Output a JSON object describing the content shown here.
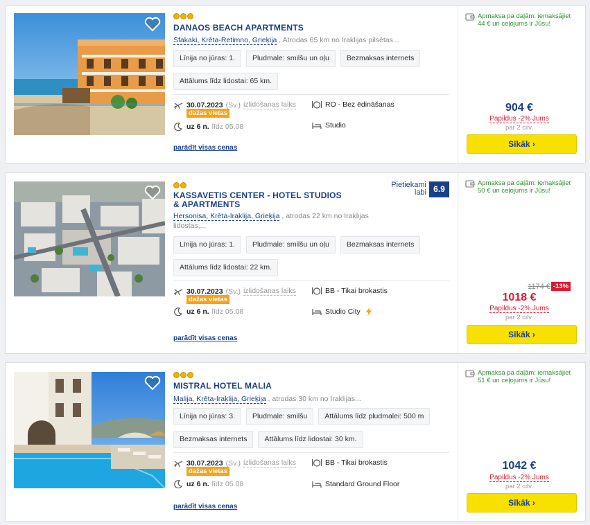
{
  "listings": [
    {
      "name": "DANAOS BEACH APARTMENTS",
      "stars": 3,
      "location_link": "Sfakaki, Krēta-Retimno, Grieķija",
      "location_rest": " , Atrodas 65 km no Iraklijas pilsētas...",
      "tags": [
        "Līnija no jūras: 1.",
        "Pludmale: smilšu un oļu",
        "Bezmaksas internets",
        "Attālums līdz lidostai: 65 km."
      ],
      "date": "30.07.2023",
      "weekday": "(Sv.)",
      "departure": "izlidošanas laiks",
      "seats_badge": "dažas vietas",
      "nights": "uz 6 n.",
      "until": "līdz 05.08",
      "board": "RO - Bez ēdināšanas",
      "room": "Studio",
      "show_prices": "parādīt visas cenas",
      "installment": "Apmaksa pa daļām: iemaksājiet 44 € un ceļojums ir Jūsu!",
      "price": "904 €",
      "extra": "Papildus -2% Jums",
      "per": "par 2 cilv.",
      "button": "Sīkāk ›"
    },
    {
      "name": "KASSAVETIS CENTER - HOTEL STUDIOS & APARTMENTS",
      "stars": 2,
      "rating_label": "Pietiekami labi",
      "rating_value": "6.9",
      "location_link": "Hersonisa, Krēta-Iraklija, Grieķija",
      "location_rest": " , atrodas 22 km no Iraklijas lidostas,...",
      "tags": [
        "Līnija no jūras: 1.",
        "Pludmale: smilšu un oļu",
        "Bezmaksas internets",
        "Attālums līdz lidostai: 22 km."
      ],
      "date": "30.07.2023",
      "weekday": "(Sv.)",
      "departure": "izlidošanas laiks",
      "seats_badge": "dažas vietas",
      "nights": "uz 6 n.",
      "until": "līdz 05.08",
      "board": "BB - Tikai brokastis",
      "room": "Studio City",
      "show_prices": "parādīt visas cenas",
      "installment": "Apmaksa pa daļām: iemaksājiet 50 € un ceļojums ir Jūsu!",
      "old_price": "1174 €",
      "discount": "-13%",
      "price": "1018 €",
      "extra": "Papildus -2% Jums",
      "per": "par 2 cilv.",
      "button": "Sīkāk ›"
    },
    {
      "name": "MISTRAL HOTEL MALIA",
      "stars": 3,
      "location_link": "Malija, Krēta-Iraklija, Grieķija",
      "location_rest": " , atrodas 30 km no Iraklijas...",
      "tags": [
        "Līnija no jūras: 3.",
        "Pludmale: smilšu",
        "Attālums līdz pludmalei: 500 m",
        "Bezmaksas internets",
        "Attālums līdz lidostai: 30 km."
      ],
      "date": "30.07.2023",
      "weekday": "(Sv.)",
      "departure": "izlidošanas laiks",
      "seats_badge": "dažas vietas",
      "nights": "uz 6 n.",
      "until": "līdz 05.08",
      "board": "BB - Tikai brokastis",
      "room": "Standard Ground Floor",
      "show_prices": "parādīt visas cenas",
      "installment": "Apmaksa pa daļām: iemaksājiet 51 € un ceļojums ir Jūsu!",
      "price": "1042 €",
      "extra": "Papildus -2% Jums",
      "per": "par 2 cilv.",
      "button": "Sīkāk ›"
    }
  ],
  "colors": {
    "brand_blue": "#1a3f8a",
    "button_yellow": "#f8e000",
    "sale_red": "#e3162e",
    "badge_orange": "#f7a21b",
    "installment_green": "#2d8f2d"
  },
  "icons": [
    "heart-icon",
    "star-icon",
    "plane-icon",
    "moon-icon",
    "cutlery-icon",
    "bed-icon",
    "wallet-icon",
    "lightning-icon"
  ]
}
